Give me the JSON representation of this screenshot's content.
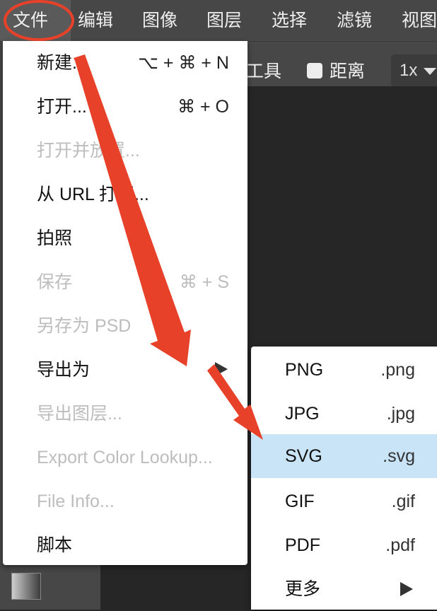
{
  "menubar": {
    "items": [
      "文件",
      "编辑",
      "图像",
      "图层",
      "选择",
      "滤镜",
      "视图"
    ]
  },
  "toolbar": {
    "tool_label": "工具",
    "distance_label": "距离",
    "zoom_value": "1x"
  },
  "file_menu": {
    "items": [
      {
        "label": "新建...",
        "shortcut": "⌥ + ⌘ + N",
        "disabled": false
      },
      {
        "label": "打开...",
        "shortcut": "⌘ + O",
        "disabled": false
      },
      {
        "label": "打开并放置...",
        "shortcut": "",
        "disabled": true
      },
      {
        "label": "从 URL 打开...",
        "shortcut": "",
        "disabled": false
      },
      {
        "label": "拍照",
        "shortcut": "",
        "disabled": false
      },
      {
        "label": "保存",
        "shortcut": "⌘ + S",
        "disabled": true
      },
      {
        "label": "另存为 PSD",
        "shortcut": "",
        "disabled": true
      },
      {
        "label": "导出为",
        "shortcut": "",
        "disabled": false,
        "submenu": true
      },
      {
        "label": "导出图层...",
        "shortcut": "",
        "disabled": true
      },
      {
        "label": "Export Color Lookup...",
        "shortcut": "",
        "disabled": true
      },
      {
        "label": "File Info...",
        "shortcut": "",
        "disabled": true
      },
      {
        "label": "脚本",
        "shortcut": "",
        "disabled": false
      }
    ]
  },
  "export_submenu": {
    "items": [
      {
        "label": "PNG",
        "ext": ".png"
      },
      {
        "label": "JPG",
        "ext": ".jpg"
      },
      {
        "label": "SVG",
        "ext": ".svg",
        "highlighted": true
      },
      {
        "label": "GIF",
        "ext": ".gif"
      },
      {
        "label": "PDF",
        "ext": ".pdf"
      },
      {
        "label": "更多",
        "ext": "",
        "submenu": true
      }
    ]
  },
  "colors": {
    "highlight": "#c9e4f6",
    "annotation": "#e8412a",
    "disabled_text": "#bdbdbd",
    "ui_dark": "#474747"
  }
}
